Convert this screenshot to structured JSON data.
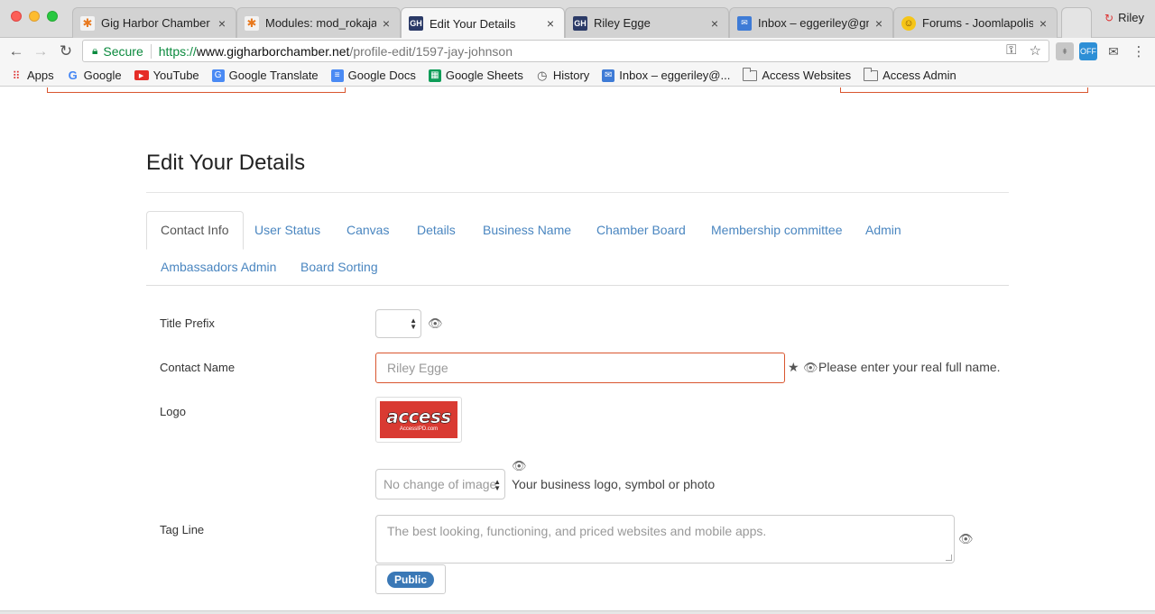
{
  "browser": {
    "tabs": [
      {
        "title": "Gig Harbor Chamber o",
        "favicon": "joomla-icon",
        "active": false
      },
      {
        "title": "Modules: mod_rokajax",
        "favicon": "joomla-icon",
        "active": false
      },
      {
        "title": "Edit Your Details",
        "favicon": "GH",
        "active": true
      },
      {
        "title": "Riley Egge",
        "favicon": "GH",
        "active": false
      },
      {
        "title": "Inbox – eggeriley@gm",
        "favicon": "inbox-icon",
        "active": false
      },
      {
        "title": "Forums - Joomlapolis",
        "favicon": "smiley-icon",
        "active": false
      }
    ],
    "profile_name": "Riley",
    "url": {
      "secure_label": "Secure",
      "scheme": "https://",
      "host": "www.gigharborchamber.net",
      "path": "/profile-edit/1597-jay-johnson"
    },
    "extension_badge": "OFF",
    "bookmarks": [
      {
        "label": "Apps",
        "icon": "apps-grid-icon"
      },
      {
        "label": "Google",
        "icon": "google-icon"
      },
      {
        "label": "YouTube",
        "icon": "youtube-icon"
      },
      {
        "label": "Google Translate",
        "icon": "translate-icon"
      },
      {
        "label": "Google Docs",
        "icon": "docs-icon"
      },
      {
        "label": "Google Sheets",
        "icon": "sheets-icon"
      },
      {
        "label": "History",
        "icon": "history-icon"
      },
      {
        "label": "Inbox – eggeriley@...",
        "icon": "inbox-icon"
      },
      {
        "label": "Access Websites",
        "icon": "folder-icon"
      },
      {
        "label": "Access Admin",
        "icon": "folder-icon"
      }
    ]
  },
  "page": {
    "title": "Edit Your Details",
    "tabs": [
      "Contact Info",
      "User Status",
      "Canvas",
      "Details",
      "Business Name",
      "Chamber Board",
      "Membership committee",
      "Admin",
      "Ambassadors Admin",
      "Board Sorting"
    ],
    "form": {
      "title_prefix_label": "Title Prefix",
      "contact_name_label": "Contact Name",
      "contact_name_value": "Riley Egge",
      "contact_name_help": "Please enter your real full name.",
      "logo_label": "Logo",
      "logo_word": "access",
      "logo_sub": "AccessIPD.com",
      "image_select_value": "No change of image",
      "logo_help": "Your business logo, symbol or photo",
      "tag_line_label": "Tag Line",
      "tag_line_value": "The best looking, functioning, and priced websites and mobile apps.",
      "public_badge": "Public"
    }
  },
  "colors": {
    "link": "#4a86c0",
    "error_border": "#d9562f",
    "badge": "#3a78b6",
    "secure": "#0b8a3e"
  }
}
